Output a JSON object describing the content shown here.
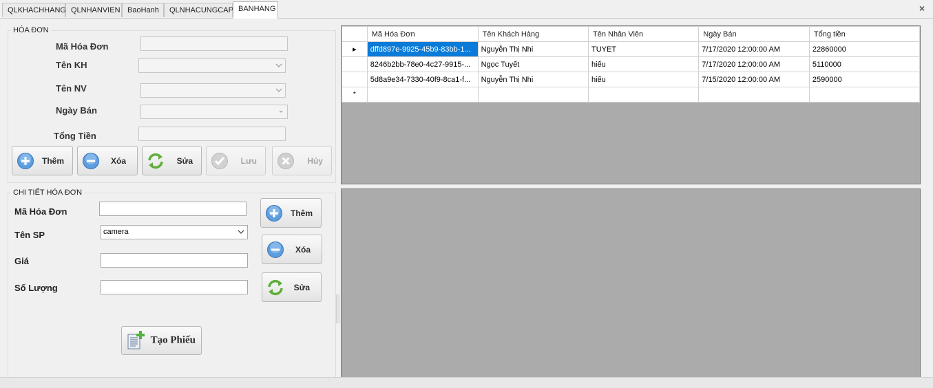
{
  "tabs": [
    {
      "label": "QLKHACHHANG"
    },
    {
      "label": "QLNHANVIEN"
    },
    {
      "label": "BaoHanh"
    },
    {
      "label": "QLNHACUNGCAP"
    },
    {
      "label": "BANHANG"
    }
  ],
  "close_glyph": "×",
  "invoice": {
    "title": "HÓA ĐƠN",
    "ma_hd_label": "Mã Hóa Đơn",
    "ten_kh_label": "Tên KH",
    "ten_nv_label": "Tên NV",
    "ngay_ban_label": "Ngày Bán",
    "tong_tien_label": "Tổng Tiền",
    "buttons": {
      "them": "Thêm",
      "xoa": "Xóa",
      "sua": "Sửa",
      "luu": "Lưu",
      "huy": "Hủy"
    }
  },
  "detail": {
    "title": "CHI TIẾT HÓA ĐƠN",
    "ma_hd_label": "Mã Hóa Đơn",
    "ten_sp_label": "Tên SP",
    "ten_sp_value": "camera",
    "gia_label": "Giá",
    "so_luong_label": "Số Lượng",
    "buttons": {
      "them": "Thêm",
      "xoa": "Xóa",
      "sua": "Sửa"
    },
    "tao_phieu": "Tạo Phiếu"
  },
  "grid": {
    "columns": [
      "Mã Hóa Đơn",
      "Tên Khách Hàng",
      "Tên Nhân Viên",
      "Ngày Bán",
      "Tổng tiền"
    ],
    "rows": [
      [
        "dffd897e-9925-45b9-83bb-1...",
        "Nguyễn Thị Nhi",
        "TUYET",
        "7/17/2020 12:00:00 AM",
        "22860000"
      ],
      [
        "8246b2bb-78e0-4c27-9915-...",
        "Ngọc Tuyết",
        "hiếu",
        "7/17/2020 12:00:00 AM",
        "5110000"
      ],
      [
        "5d8a9e34-7330-40f9-8ca1-f...",
        "Nguyễn Thị Nhi",
        "hiếu",
        "7/15/2020 12:00:00 AM",
        "2590000"
      ]
    ],
    "current_marker": "▸",
    "new_row_marker": "*"
  },
  "colors": {
    "selection": "#0a7bd8",
    "grid_bg": "#ababab"
  }
}
